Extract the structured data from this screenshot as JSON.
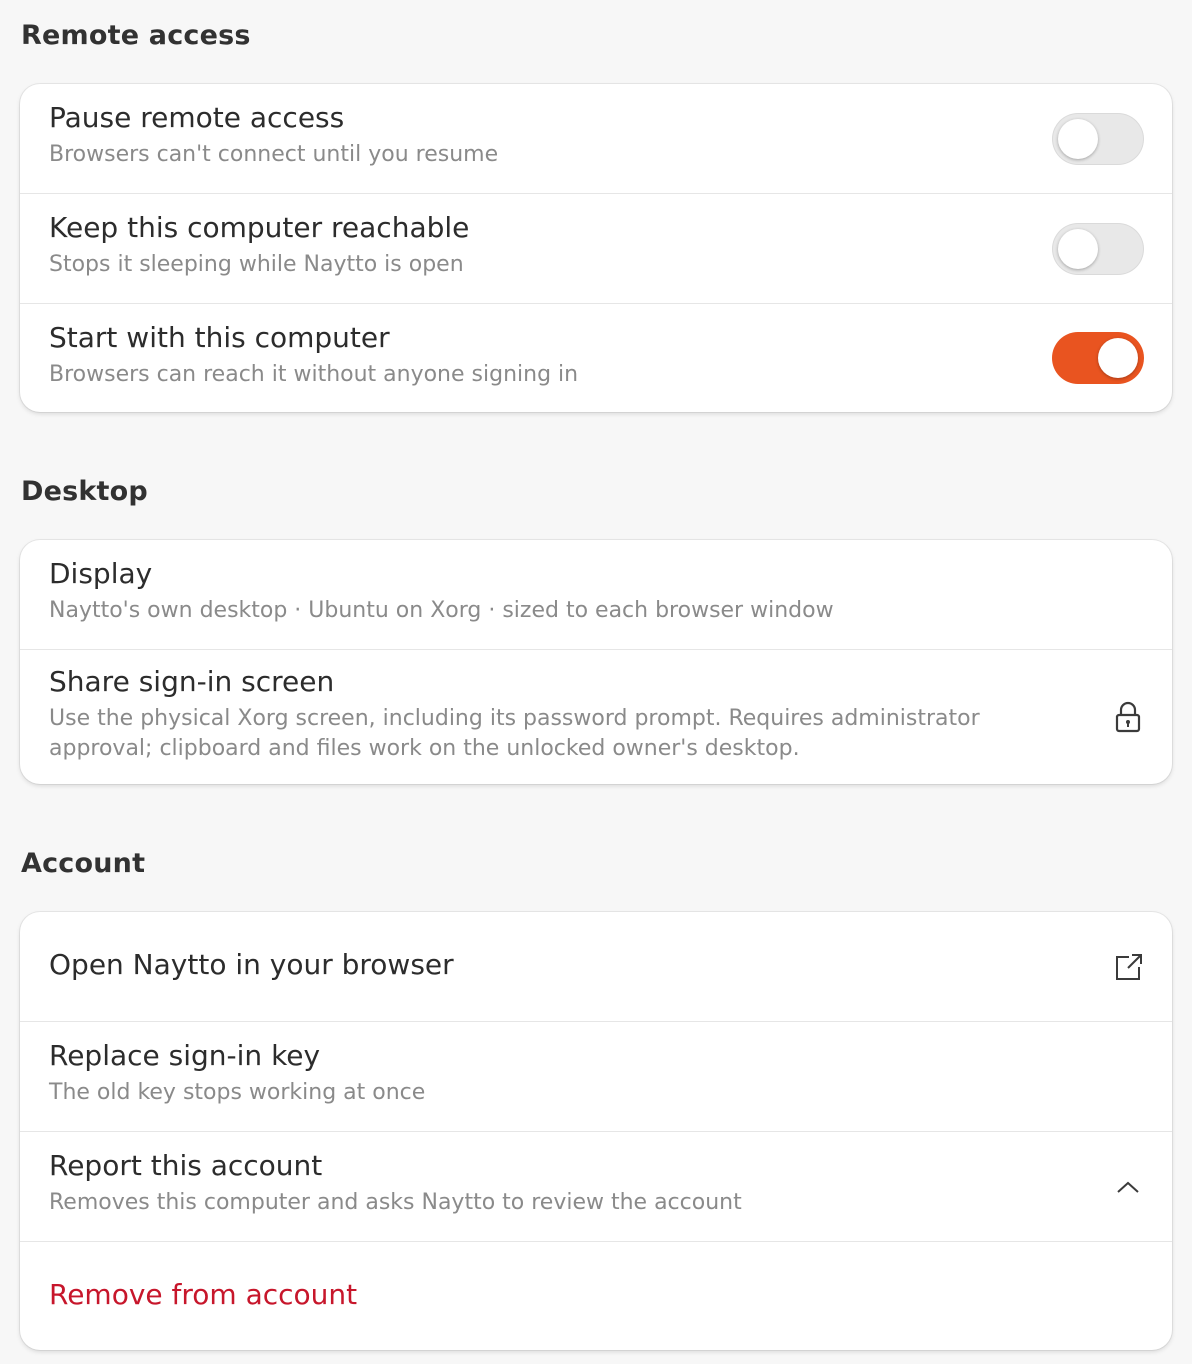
{
  "sections": {
    "remote_access": {
      "title": "Remote access",
      "rows": [
        {
          "title": "Pause remote access",
          "subtitle": "Browsers can't connect until you resume",
          "toggle": "off"
        },
        {
          "title": "Keep this computer reachable",
          "subtitle": "Stops it sleeping while Naytto is open",
          "toggle": "off"
        },
        {
          "title": "Start with this computer",
          "subtitle": "Browsers can reach it without anyone signing in",
          "toggle": "on"
        }
      ]
    },
    "desktop": {
      "title": "Desktop",
      "rows": [
        {
          "title": "Display",
          "subtitle": "Naytto's own desktop · Ubuntu on Xorg · sized to each browser window"
        },
        {
          "title": "Share sign-in screen",
          "subtitle": "Use the physical Xorg screen, including its password prompt. Requires administrator approval; clipboard and files work on the unlocked owner's desktop.",
          "icon": "lock-icon"
        }
      ]
    },
    "account": {
      "title": "Account",
      "rows": [
        {
          "title": "Open Naytto in your browser",
          "icon": "external-link-icon"
        },
        {
          "title": "Replace sign-in key",
          "subtitle": "The old key stops working at once"
        },
        {
          "title": "Report this account",
          "subtitle": "Removes this computer and asks Naytto to review the account",
          "icon": "chevron-up-icon",
          "expanded": true
        },
        {
          "title": "Remove from account",
          "style": "danger"
        }
      ]
    }
  },
  "colors": {
    "accent": "#e95420",
    "danger": "#c7162b",
    "background": "#f7f7f7",
    "card": "#ffffff",
    "subtitle": "#8a8a8a"
  }
}
